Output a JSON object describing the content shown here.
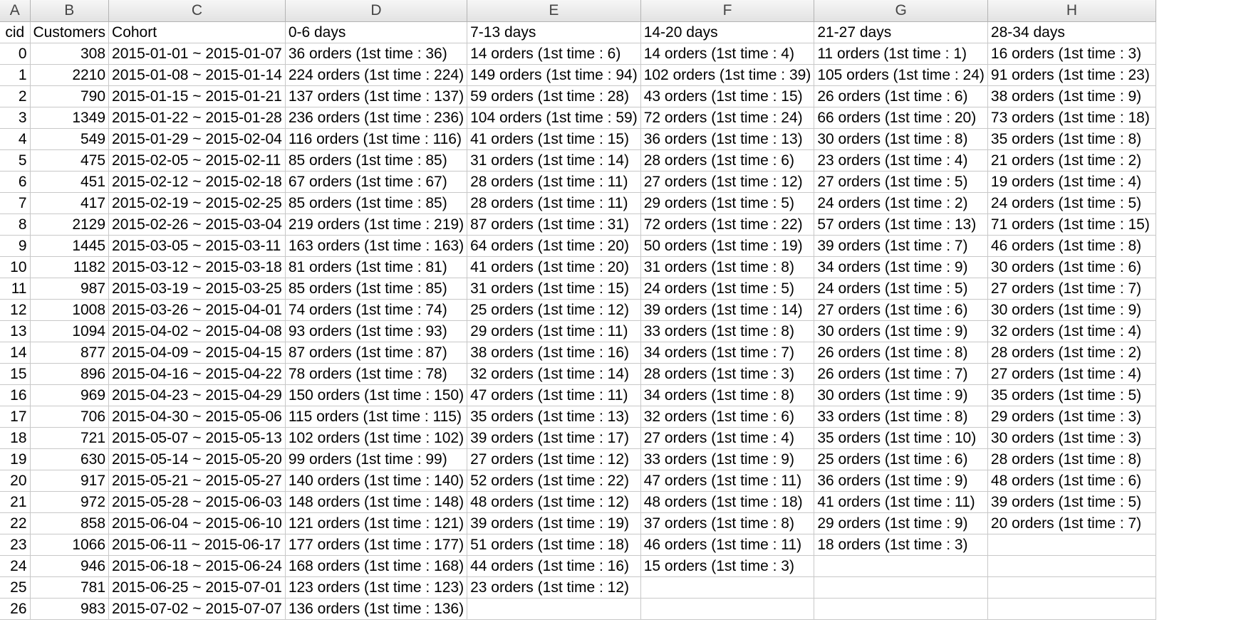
{
  "column_letters": [
    "A",
    "B",
    "C",
    "D",
    "E",
    "F",
    "G",
    "H"
  ],
  "header_row": [
    "cid",
    "Customers",
    "Cohort",
    "0-6 days",
    "7-13 days",
    "14-20 days",
    "21-27 days",
    "28-34 days"
  ],
  "rows": [
    [
      "0",
      "308",
      "2015-01-01 ~ 2015-01-07",
      "36 orders (1st time : 36)",
      "14 orders (1st time : 6)",
      "14 orders (1st time : 4)",
      "11 orders (1st time : 1)",
      "16 orders (1st time : 3)"
    ],
    [
      "1",
      "2210",
      "2015-01-08 ~ 2015-01-14",
      "224 orders (1st time : 224)",
      "149 orders (1st time : 94)",
      "102 orders (1st time : 39)",
      "105 orders (1st time : 24)",
      "91 orders (1st time : 23)"
    ],
    [
      "2",
      "790",
      "2015-01-15 ~ 2015-01-21",
      "137 orders (1st time : 137)",
      "59 orders (1st time : 28)",
      "43 orders (1st time : 15)",
      "26 orders (1st time : 6)",
      "38 orders (1st time : 9)"
    ],
    [
      "3",
      "1349",
      "2015-01-22 ~ 2015-01-28",
      "236 orders (1st time : 236)",
      "104 orders (1st time : 59)",
      "72 orders (1st time : 24)",
      "66 orders (1st time : 20)",
      "73 orders (1st time : 18)"
    ],
    [
      "4",
      "549",
      "2015-01-29 ~ 2015-02-04",
      "116 orders (1st time : 116)",
      "41 orders (1st time : 15)",
      "36 orders (1st time : 13)",
      "30 orders (1st time : 8)",
      "35 orders (1st time : 8)"
    ],
    [
      "5",
      "475",
      "2015-02-05 ~ 2015-02-11",
      "85 orders (1st time : 85)",
      "31 orders (1st time : 14)",
      "28 orders (1st time : 6)",
      "23 orders (1st time : 4)",
      "21 orders (1st time : 2)"
    ],
    [
      "6",
      "451",
      "2015-02-12 ~ 2015-02-18",
      "67 orders (1st time : 67)",
      "28 orders (1st time : 11)",
      "27 orders (1st time : 12)",
      "27 orders (1st time : 5)",
      "19 orders (1st time : 4)"
    ],
    [
      "7",
      "417",
      "2015-02-19 ~ 2015-02-25",
      "85 orders (1st time : 85)",
      "28 orders (1st time : 11)",
      "29 orders (1st time : 5)",
      "24 orders (1st time : 2)",
      "24 orders (1st time : 5)"
    ],
    [
      "8",
      "2129",
      "2015-02-26 ~ 2015-03-04",
      "219 orders (1st time : 219)",
      "87 orders (1st time : 31)",
      "72 orders (1st time : 22)",
      "57 orders (1st time : 13)",
      "71 orders (1st time : 15)"
    ],
    [
      "9",
      "1445",
      "2015-03-05 ~ 2015-03-11",
      "163 orders (1st time : 163)",
      "64 orders (1st time : 20)",
      "50 orders (1st time : 19)",
      "39 orders (1st time : 7)",
      "46 orders (1st time : 8)"
    ],
    [
      "10",
      "1182",
      "2015-03-12 ~ 2015-03-18",
      "81 orders (1st time : 81)",
      "41 orders (1st time : 20)",
      "31 orders (1st time : 8)",
      "34 orders (1st time : 9)",
      "30 orders (1st time : 6)"
    ],
    [
      "11",
      "987",
      "2015-03-19 ~ 2015-03-25",
      "85 orders (1st time : 85)",
      "31 orders (1st time : 15)",
      "24 orders (1st time : 5)",
      "24 orders (1st time : 5)",
      "27 orders (1st time : 7)"
    ],
    [
      "12",
      "1008",
      "2015-03-26 ~ 2015-04-01",
      "74 orders (1st time : 74)",
      "25 orders (1st time : 12)",
      "39 orders (1st time : 14)",
      "27 orders (1st time : 6)",
      "30 orders (1st time : 9)"
    ],
    [
      "13",
      "1094",
      "2015-04-02 ~ 2015-04-08",
      "93 orders (1st time : 93)",
      "29 orders (1st time : 11)",
      "33 orders (1st time : 8)",
      "30 orders (1st time : 9)",
      "32 orders (1st time : 4)"
    ],
    [
      "14",
      "877",
      "2015-04-09 ~ 2015-04-15",
      "87 orders (1st time : 87)",
      "38 orders (1st time : 16)",
      "34 orders (1st time : 7)",
      "26 orders (1st time : 8)",
      "28 orders (1st time : 2)"
    ],
    [
      "15",
      "896",
      "2015-04-16 ~ 2015-04-22",
      "78 orders (1st time : 78)",
      "32 orders (1st time : 14)",
      "28 orders (1st time : 3)",
      "26 orders (1st time : 7)",
      "27 orders (1st time : 4)"
    ],
    [
      "16",
      "969",
      "2015-04-23 ~ 2015-04-29",
      "150 orders (1st time : 150)",
      "47 orders (1st time : 11)",
      "34 orders (1st time : 8)",
      "30 orders (1st time : 9)",
      "35 orders (1st time : 5)"
    ],
    [
      "17",
      "706",
      "2015-04-30 ~ 2015-05-06",
      "115 orders (1st time : 115)",
      "35 orders (1st time : 13)",
      "32 orders (1st time : 6)",
      "33 orders (1st time : 8)",
      "29 orders (1st time : 3)"
    ],
    [
      "18",
      "721",
      "2015-05-07 ~ 2015-05-13",
      "102 orders (1st time : 102)",
      "39 orders (1st time : 17)",
      "27 orders (1st time : 4)",
      "35 orders (1st time : 10)",
      "30 orders (1st time : 3)"
    ],
    [
      "19",
      "630",
      "2015-05-14 ~ 2015-05-20",
      "99 orders (1st time : 99)",
      "27 orders (1st time : 12)",
      "33 orders (1st time : 9)",
      "25 orders (1st time : 6)",
      "28 orders (1st time : 8)"
    ],
    [
      "20",
      "917",
      "2015-05-21 ~ 2015-05-27",
      "140 orders (1st time : 140)",
      "52 orders (1st time : 22)",
      "47 orders (1st time : 11)",
      "36 orders (1st time : 9)",
      "48 orders (1st time : 6)"
    ],
    [
      "21",
      "972",
      "2015-05-28 ~ 2015-06-03",
      "148 orders (1st time : 148)",
      "48 orders (1st time : 12)",
      "48 orders (1st time : 18)",
      "41 orders (1st time : 11)",
      "39 orders (1st time : 5)"
    ],
    [
      "22",
      "858",
      "2015-06-04 ~ 2015-06-10",
      "121 orders (1st time : 121)",
      "39 orders (1st time : 19)",
      "37 orders (1st time : 8)",
      "29 orders (1st time : 9)",
      "20 orders (1st time : 7)"
    ],
    [
      "23",
      "1066",
      "2015-06-11 ~ 2015-06-17",
      "177 orders (1st time : 177)",
      "51 orders (1st time : 18)",
      "46 orders (1st time : 11)",
      "18 orders (1st time : 3)",
      ""
    ],
    [
      "24",
      "946",
      "2015-06-18 ~ 2015-06-24",
      "168 orders (1st time : 168)",
      "44 orders (1st time : 16)",
      "15 orders (1st time : 3)",
      "",
      ""
    ],
    [
      "25",
      "781",
      "2015-06-25 ~ 2015-07-01",
      "123 orders (1st time : 123)",
      "23 orders (1st time : 12)",
      "",
      "",
      ""
    ],
    [
      "26",
      "983",
      "2015-07-02 ~ 2015-07-07",
      "136 orders (1st time : 136)",
      "",
      "",
      "",
      ""
    ]
  ]
}
